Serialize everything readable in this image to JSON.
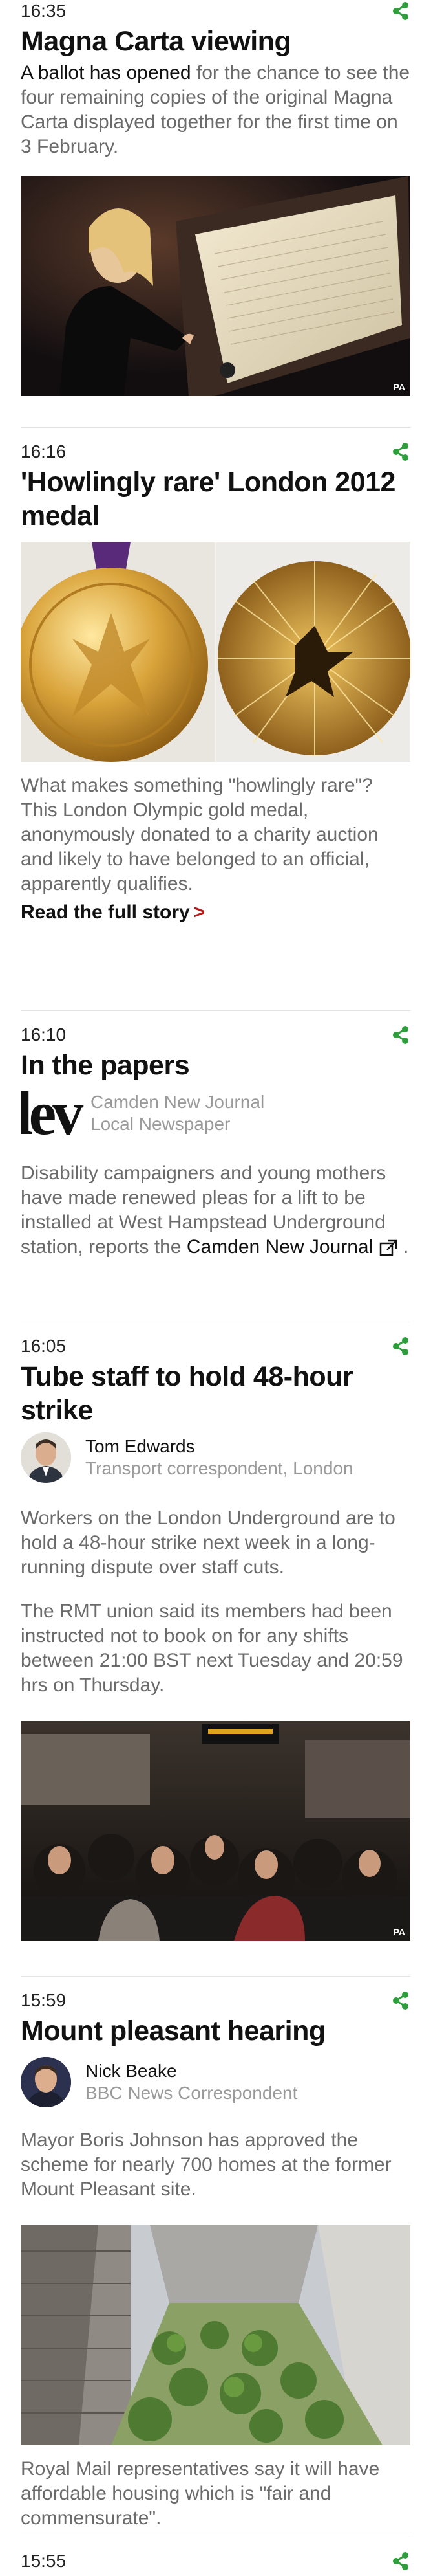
{
  "colors": {
    "share_green": "#2e9f3c",
    "link_red": "#bb1919",
    "grey_text": "#6b6b6b"
  },
  "icons": {
    "share": "share-icon",
    "external": "external-link-icon",
    "chevron": "chevron-right-icon"
  },
  "posts": [
    {
      "time": "16:35",
      "title": "Magna Carta viewing",
      "body_link": "A ballot has opened",
      "body_rest": " for the chance to see the four remaining copies of the original Magna Carta displayed together for the first time on 3 February.",
      "image_credit": "PA"
    },
    {
      "time": "16:16",
      "title": "'Howlingly rare' London 2012 medal",
      "body": "What makes something \"howlingly rare\"? This London Olympic gold medal, anonymously donated to a charity auction and likely to have belonged to an official, apparently qualifies.",
      "read_more": "Read the full story"
    },
    {
      "time": "16:10",
      "title": "In the papers",
      "logo_text": "lev",
      "source_name": "Camden New Journal",
      "source_type": "Local Newspaper",
      "body_before": "Disability campaigners and young mothers have made renewed pleas for a lift to be installed at West Hampstead Underground station, reports the ",
      "body_link": "Camden New Journal",
      "body_after": " ."
    },
    {
      "time": "16:05",
      "title": "Tube staff to hold 48-hour strike",
      "author_name": "Tom Edwards",
      "author_role": "Transport correspondent, London",
      "body1": "Workers on the London Underground are to hold a 48-hour strike next week in a long-running dispute over staff cuts.",
      "body2": "The RMT union said its members had been instructed not to book on for any shifts between 21:00 BST next Tuesday and 20:59 hrs on Thursday.",
      "image_credit": "PA"
    },
    {
      "time": "15:59",
      "title": "Mount pleasant hearing",
      "author_name": "Nick Beake",
      "author_role": "BBC News Correspondent",
      "body1": "Mayor Boris Johnson has approved the scheme for nearly 700 homes at the former Mount Pleasant site.",
      "body2": "Royal Mail representatives say it will have affordable housing which is \"fair and commensurate\"."
    },
    {
      "time": "15:55"
    }
  ]
}
